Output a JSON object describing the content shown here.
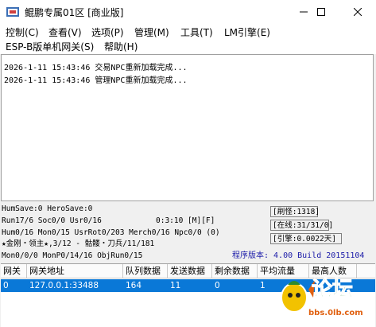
{
  "window": {
    "title": "鲲鹏专属01区 [商业版]",
    "accent": "#0a78d7"
  },
  "menu": {
    "row1": [
      "控制(C)",
      "查看(V)",
      "选项(P)",
      "管理(M)",
      "工具(T)",
      "LM引擎(E)"
    ],
    "row2": [
      "ESP-B版单机网关(S)",
      "帮助(H)"
    ]
  },
  "log": [
    "2026-1-11 15:43:46 交易NPC重新加载完成...",
    "2026-1-11 15:43:46 管理NPC重新加载完成..."
  ],
  "status": {
    "line1": "HumSave:0 HeroSave:0",
    "line2": "Run17/6 Soc0/0 Usr0/16",
    "line2_right": "0:3:10 [M][F]",
    "line3": "Hum0/16 Mon0/15 UsrRot0/203 Merch0/16 Npc0/0 (0)",
    "line4": "★金刚・领主★,3/12 - 骷髅・刀兵/11/181",
    "line5": "Mon0/0/0 MonP0/14/16 ObjRun0/15",
    "refresh": "[刷怪:1318]",
    "online": "[在线:31/31/0]",
    "engine": "[引擎:0.0022天]",
    "version": "程序版本: 4.00 Build 20151104"
  },
  "table": {
    "headers": [
      "网关",
      "网关地址",
      "队列数据",
      "发送数据",
      "剩余数据",
      "平均流量",
      "最高人数"
    ],
    "rows": [
      [
        "0",
        "127.0.0.1:33488",
        "164",
        "11",
        "0",
        "1",
        ""
      ]
    ]
  },
  "watermark": {
    "text": "论坛",
    "url": "bbs.0lb.com"
  }
}
